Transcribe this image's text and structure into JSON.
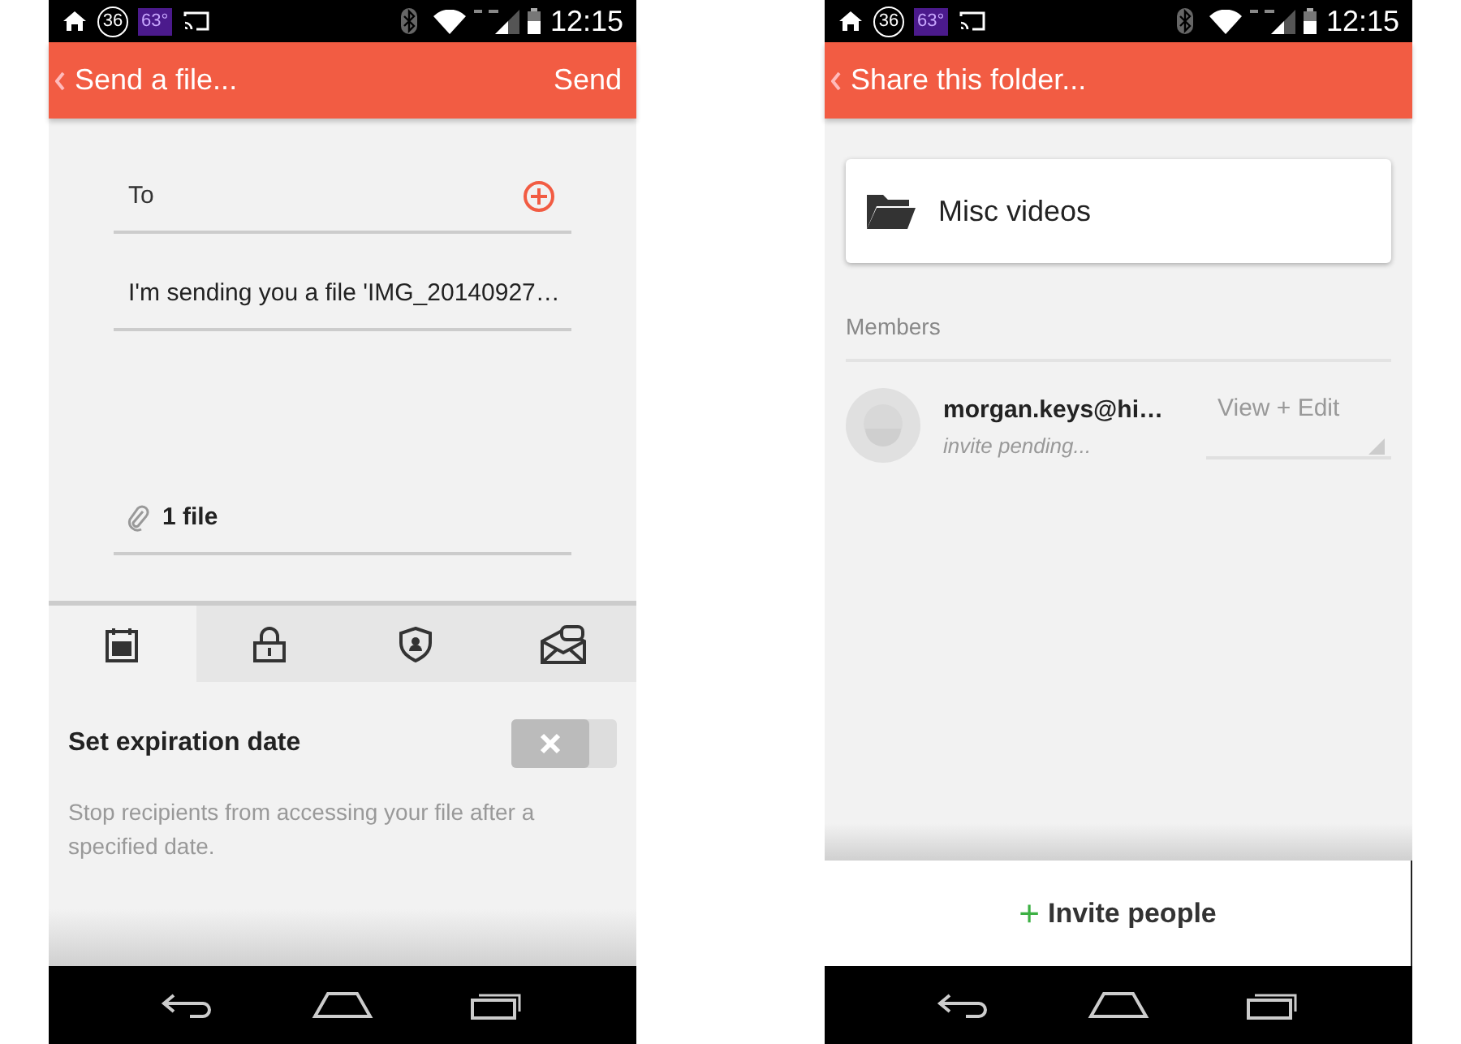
{
  "screens": [
    {
      "status_bar": {
        "notification_count": "36",
        "temperature": "63°",
        "time": "12:15"
      },
      "header": {
        "title": "Send a file...",
        "action": "Send"
      },
      "form": {
        "to": {
          "placeholder": "To"
        },
        "message": {
          "value": "I'm sending you a file 'IMG_20140927…"
        },
        "attachment": "1 file"
      },
      "tabs": [
        {
          "kind": "calendar",
          "selected": true
        },
        {
          "kind": "lock",
          "selected": false
        },
        {
          "kind": "shield",
          "selected": false
        },
        {
          "kind": "mail",
          "selected": false
        }
      ],
      "setting": {
        "title": "Set expiration date",
        "on": false,
        "description": "Stop recipients from accessing your file after a specified date."
      }
    },
    {
      "status_bar": {
        "notification_count": "36",
        "temperature": "63°",
        "time": "12:15"
      },
      "header": {
        "title": "Share this folder..."
      },
      "folder": {
        "name": "Misc videos"
      },
      "members_label": "Members",
      "members": [
        {
          "email": "morgan.keys@hi…",
          "status": "invite pending...",
          "permission": "View + Edit"
        }
      ],
      "invite_button": {
        "icon": "+",
        "label": "Invite people"
      }
    }
  ]
}
